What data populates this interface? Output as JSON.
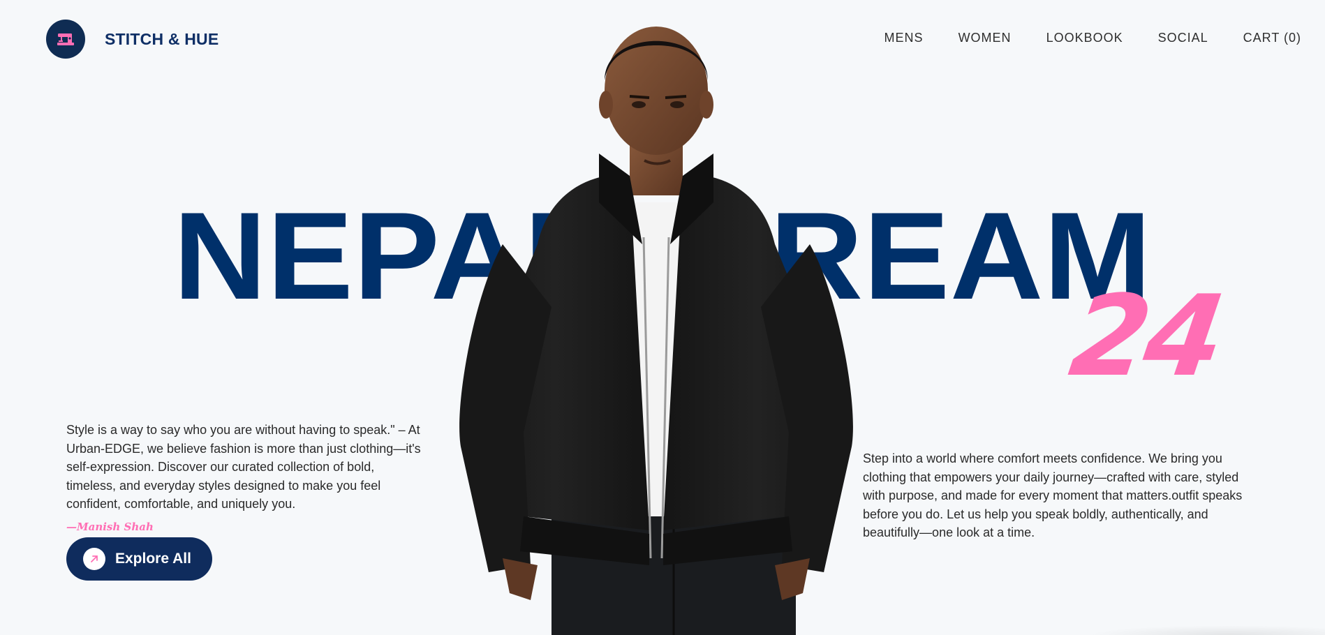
{
  "brand": {
    "name": "STITCH & HUE",
    "logo_icon": "sewing-machine-icon"
  },
  "nav": {
    "items": [
      {
        "label": "MENS"
      },
      {
        "label": "WOMEN"
      },
      {
        "label": "LOOKBOOK"
      },
      {
        "label": "SOCIAL"
      },
      {
        "label": "CART (0)"
      }
    ]
  },
  "hero": {
    "headline": "NEPALI DREAM",
    "year": "24",
    "model_image": "man-in-black-zip-jacket-photo"
  },
  "left_copy": {
    "paragraph": "Style is a way to say who you are without having to speak.\" – At Urban-EDGE, we believe fashion is more than just clothing—it's self-expression. Discover our curated collection of bold, timeless, and everyday styles designed to make you feel confident, comfortable, and uniquely you.",
    "signature": "—Manish Shah",
    "cta": {
      "label": "Explore All",
      "icon": "arrow-up-right-icon"
    }
  },
  "right_copy": {
    "paragraph": "Step into a world where comfort meets confidence. We bring you clothing that empowers your daily journey—crafted with care, styled with purpose, and made for every moment that matters.outfit speaks before you do. Let us help you speak boldly, authentically, and beautifully—one look at a time."
  },
  "colors": {
    "background": "#f6f8fa",
    "navy": "#00306a",
    "pink": "#ff6eb4",
    "button": "#0f2c5d"
  }
}
